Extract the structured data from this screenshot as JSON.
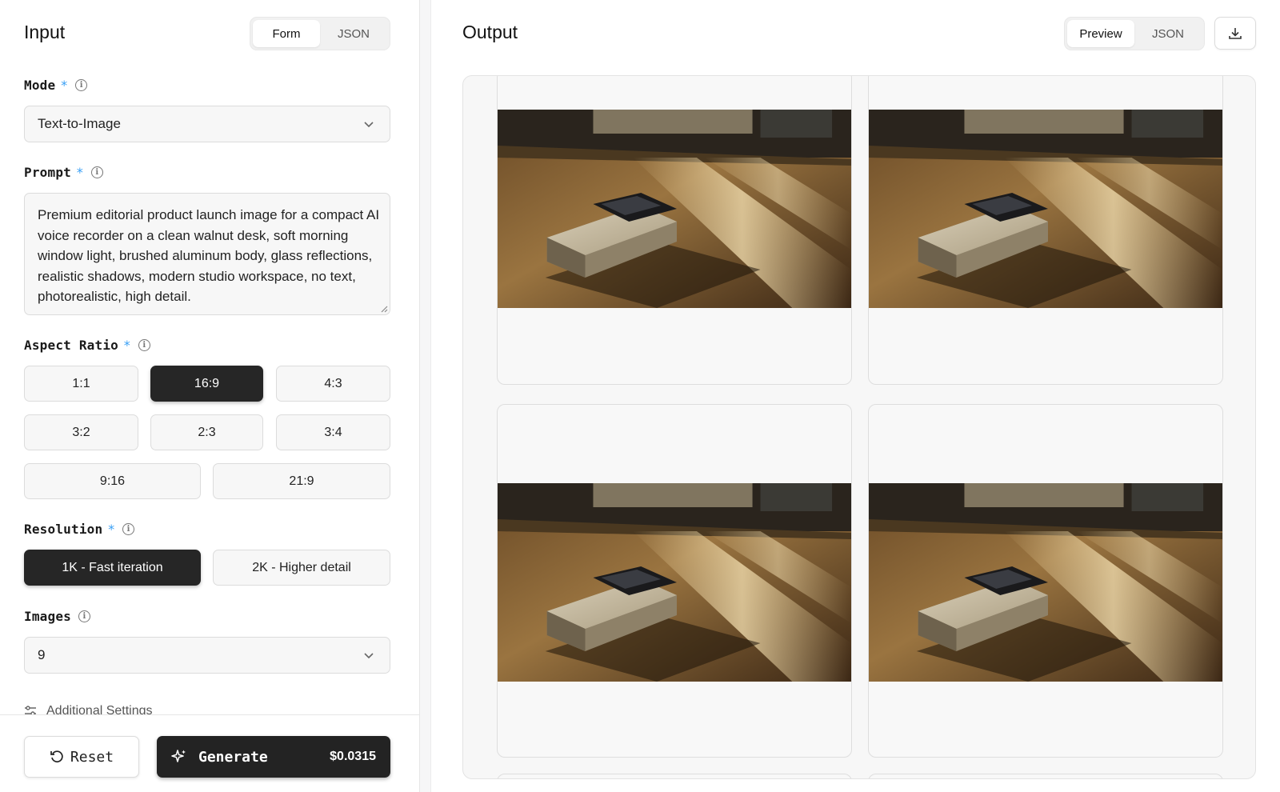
{
  "input": {
    "title": "Input",
    "view_tabs": [
      {
        "label": "Form",
        "active": true
      },
      {
        "label": "JSON",
        "active": false
      }
    ],
    "mode": {
      "label": "Mode",
      "required": "*",
      "value": "Text-to-Image"
    },
    "prompt": {
      "label": "Prompt",
      "required": "*",
      "value": "Premium editorial product launch image for a compact AI voice recorder on a clean walnut desk, soft morning window light, brushed aluminum body, glass reflections, realistic shadows, modern studio workspace, no text, photorealistic, high detail."
    },
    "aspect_ratio": {
      "label": "Aspect Ratio",
      "required": "*",
      "options": [
        "1:1",
        "16:9",
        "4:3",
        "3:2",
        "2:3",
        "3:4",
        "9:16",
        "21:9"
      ],
      "selected": "16:9"
    },
    "resolution": {
      "label": "Resolution",
      "required": "*",
      "options": [
        "1K - Fast iteration",
        "2K - Higher detail"
      ],
      "selected": "1K - Fast iteration"
    },
    "images": {
      "label": "Images",
      "value": "9"
    },
    "additional_settings": {
      "label": "Additional Settings"
    },
    "reset_label": "Reset",
    "generate_label": "Generate",
    "generate_price": "$0.0315"
  },
  "output": {
    "title": "Output",
    "view_tabs": [
      {
        "label": "Preview",
        "active": true
      },
      {
        "label": "JSON",
        "active": false
      }
    ],
    "download_icon": "download-icon",
    "images": [
      {
        "subject": "voice recorder on walnut desk"
      },
      {
        "subject": "voice recorder on walnut desk"
      },
      {
        "subject": "voice recorder on walnut desk"
      },
      {
        "subject": "voice recorder on walnut desk"
      }
    ]
  },
  "colors": {
    "accent_required": "#3aa0f5",
    "selected_bg": "#262626",
    "panel_bg": "#f7f7f7"
  }
}
